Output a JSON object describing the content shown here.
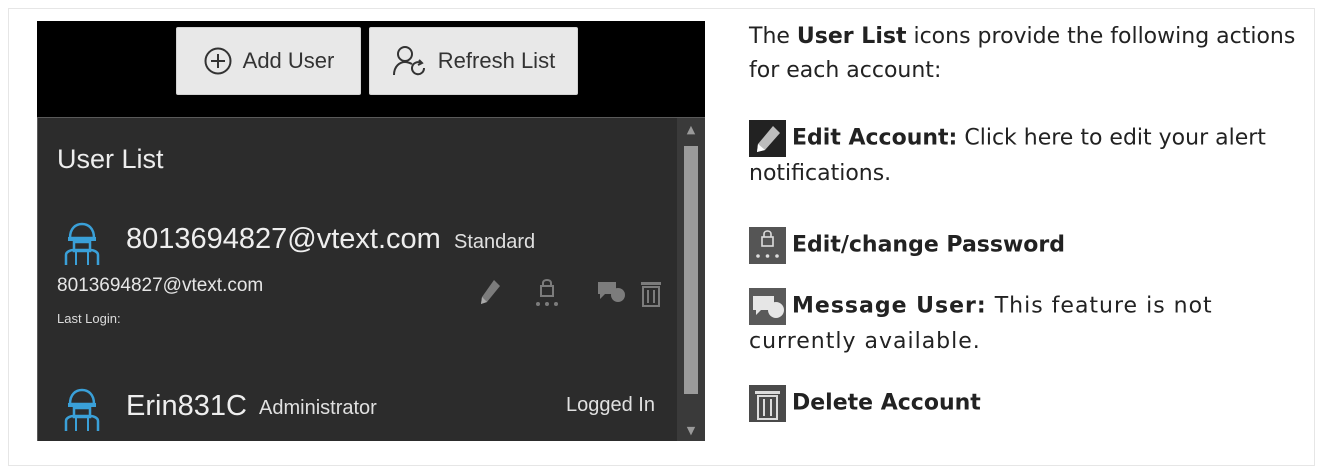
{
  "toolbar": {
    "add_user_label": "Add User",
    "refresh_list_label": "Refresh List"
  },
  "user_list": {
    "title": "User List",
    "users": [
      {
        "name": "8013694827@vtext.com",
        "role": "Standard",
        "email": "8013694827@vtext.com",
        "last_login_label": "Last Login:",
        "status": ""
      },
      {
        "name": "Erin831C",
        "role": "Administrator",
        "status": "Logged In"
      }
    ]
  },
  "row_icons": [
    "pencil-icon",
    "lock-password-icon",
    "message-icon",
    "trash-icon"
  ],
  "help": {
    "intro_prefix": "The ",
    "intro_bold": "User List",
    "intro_suffix": " icons provide the following actions for each account:",
    "items": [
      {
        "icon": "pencil-icon",
        "title": "Edit Account:",
        "text": " Click here to edit your alert notifications."
      },
      {
        "icon": "lock-password-icon",
        "title": "Edit/change Password",
        "text": ""
      },
      {
        "icon": "message-icon",
        "title": "Message User:",
        "text": " This feature is not currently available."
      },
      {
        "icon": "trash-icon",
        "title": "Delete Account",
        "text": ""
      }
    ]
  },
  "colors": {
    "panel_bg": "#2c2c2c",
    "avatar_accent": "#3aa0d8",
    "button_bg": "#e8e8e8"
  }
}
